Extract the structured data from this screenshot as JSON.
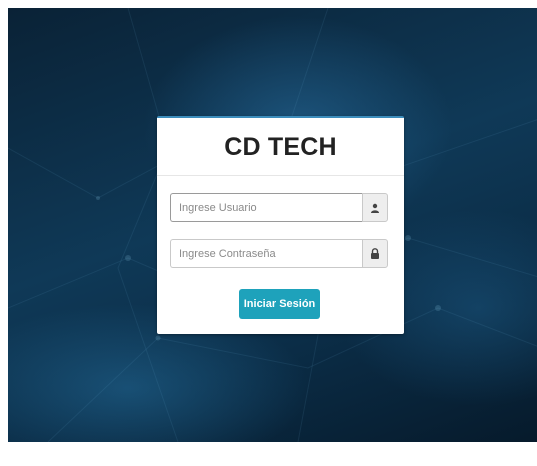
{
  "login": {
    "title": "CD TECH",
    "username_placeholder": "Ingrese Usuario",
    "username_icon": "user-icon",
    "password_placeholder": "Ingrese Contraseña",
    "password_icon": "lock-icon",
    "submit_label": "Iniciar Sesión"
  },
  "colors": {
    "accent_top_border": "#3c8dbc",
    "button": "#1ea2bb",
    "background": "#0f3957"
  }
}
